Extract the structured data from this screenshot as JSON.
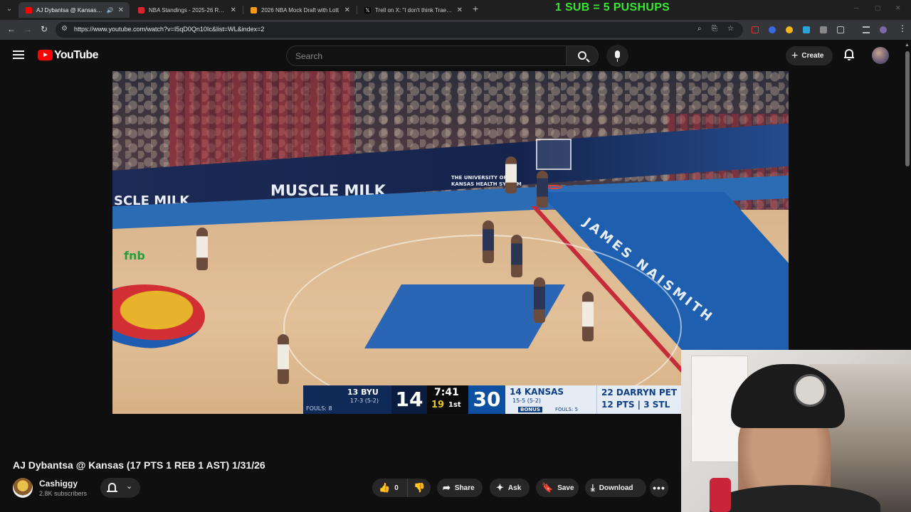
{
  "browser": {
    "tabs": [
      {
        "label": "AJ Dybantsa @ Kansas (17 PTS",
        "active": true,
        "favicon_color": "#ff0000"
      },
      {
        "label": "NBA Standings - 2025-26 Regu",
        "active": false,
        "favicon_color": "#d6262e"
      },
      {
        "label": "2026 NBA Mock Draft with Lott",
        "active": false,
        "favicon_color": "#f29b1c"
      },
      {
        "label": "Trell on X: \"I don't think Trae Yo",
        "active": false,
        "favicon_color": "#ffffff"
      }
    ],
    "tab_close": "✕",
    "new_tab": "+",
    "banner": "1 SUB = 5 PUSHUPS",
    "url": "https://www.youtube.com/watch?v=I5qD0Qn10Ic&list=WL&index=2"
  },
  "youtube": {
    "logo_text": "YouTube",
    "search_placeholder": "Search",
    "create_label": "Create"
  },
  "video": {
    "ad_texts": [
      "SCLE MILK",
      "MUSCLE MILK",
      "THE UNIVERSITY OF KANSAS HEALTH SYSTEM",
      "fnb",
      "JAMES NAISMITH"
    ],
    "scoreboard": {
      "team1": "13 BYU",
      "team1_record": "17-3 (5-2)",
      "team1_fouls": "FOULS: 8",
      "score1": "14",
      "clock": "7:41",
      "shot_clock": "19",
      "period": "1st",
      "score2": "30",
      "team2": "14 KANSAS",
      "team2_record": "15-5 (5-2)",
      "bonus": "BONUS",
      "team2_fouls": "FOULS: 5",
      "player_name": "22 DARRYN PET",
      "player_stats": "12 PTS | 3 STL"
    }
  },
  "watch": {
    "title": "AJ Dybantsa @ Kansas (17 PTS 1 REB 1 AST) 1/31/26",
    "channel_name": "Cashiggy",
    "subscribers": "2.8K subscribers",
    "like_count": "0",
    "share_label": "Share",
    "ask_label": "Ask",
    "save_label": "Save",
    "download_label": "Download"
  }
}
